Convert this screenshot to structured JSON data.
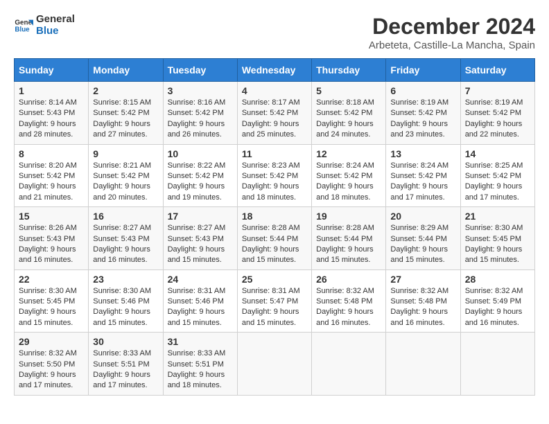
{
  "logo": {
    "line1": "General",
    "line2": "Blue"
  },
  "title": "December 2024",
  "subtitle": "Arbeteta, Castille-La Mancha, Spain",
  "days_header": [
    "Sunday",
    "Monday",
    "Tuesday",
    "Wednesday",
    "Thursday",
    "Friday",
    "Saturday"
  ],
  "weeks": [
    [
      {
        "day": "1",
        "sunrise": "8:14 AM",
        "sunset": "5:43 PM",
        "daylight": "9 hours and 28 minutes."
      },
      {
        "day": "2",
        "sunrise": "8:15 AM",
        "sunset": "5:42 PM",
        "daylight": "9 hours and 27 minutes."
      },
      {
        "day": "3",
        "sunrise": "8:16 AM",
        "sunset": "5:42 PM",
        "daylight": "9 hours and 26 minutes."
      },
      {
        "day": "4",
        "sunrise": "8:17 AM",
        "sunset": "5:42 PM",
        "daylight": "9 hours and 25 minutes."
      },
      {
        "day": "5",
        "sunrise": "8:18 AM",
        "sunset": "5:42 PM",
        "daylight": "9 hours and 24 minutes."
      },
      {
        "day": "6",
        "sunrise": "8:19 AM",
        "sunset": "5:42 PM",
        "daylight": "9 hours and 23 minutes."
      },
      {
        "day": "7",
        "sunrise": "8:19 AM",
        "sunset": "5:42 PM",
        "daylight": "9 hours and 22 minutes."
      }
    ],
    [
      {
        "day": "8",
        "sunrise": "8:20 AM",
        "sunset": "5:42 PM",
        "daylight": "9 hours and 21 minutes."
      },
      {
        "day": "9",
        "sunrise": "8:21 AM",
        "sunset": "5:42 PM",
        "daylight": "9 hours and 20 minutes."
      },
      {
        "day": "10",
        "sunrise": "8:22 AM",
        "sunset": "5:42 PM",
        "daylight": "9 hours and 19 minutes."
      },
      {
        "day": "11",
        "sunrise": "8:23 AM",
        "sunset": "5:42 PM",
        "daylight": "9 hours and 18 minutes."
      },
      {
        "day": "12",
        "sunrise": "8:24 AM",
        "sunset": "5:42 PM",
        "daylight": "9 hours and 18 minutes."
      },
      {
        "day": "13",
        "sunrise": "8:24 AM",
        "sunset": "5:42 PM",
        "daylight": "9 hours and 17 minutes."
      },
      {
        "day": "14",
        "sunrise": "8:25 AM",
        "sunset": "5:42 PM",
        "daylight": "9 hours and 17 minutes."
      }
    ],
    [
      {
        "day": "15",
        "sunrise": "8:26 AM",
        "sunset": "5:43 PM",
        "daylight": "9 hours and 16 minutes."
      },
      {
        "day": "16",
        "sunrise": "8:27 AM",
        "sunset": "5:43 PM",
        "daylight": "9 hours and 16 minutes."
      },
      {
        "day": "17",
        "sunrise": "8:27 AM",
        "sunset": "5:43 PM",
        "daylight": "9 hours and 15 minutes."
      },
      {
        "day": "18",
        "sunrise": "8:28 AM",
        "sunset": "5:44 PM",
        "daylight": "9 hours and 15 minutes."
      },
      {
        "day": "19",
        "sunrise": "8:28 AM",
        "sunset": "5:44 PM",
        "daylight": "9 hours and 15 minutes."
      },
      {
        "day": "20",
        "sunrise": "8:29 AM",
        "sunset": "5:44 PM",
        "daylight": "9 hours and 15 minutes."
      },
      {
        "day": "21",
        "sunrise": "8:30 AM",
        "sunset": "5:45 PM",
        "daylight": "9 hours and 15 minutes."
      }
    ],
    [
      {
        "day": "22",
        "sunrise": "8:30 AM",
        "sunset": "5:45 PM",
        "daylight": "9 hours and 15 minutes."
      },
      {
        "day": "23",
        "sunrise": "8:30 AM",
        "sunset": "5:46 PM",
        "daylight": "9 hours and 15 minutes."
      },
      {
        "day": "24",
        "sunrise": "8:31 AM",
        "sunset": "5:46 PM",
        "daylight": "9 hours and 15 minutes."
      },
      {
        "day": "25",
        "sunrise": "8:31 AM",
        "sunset": "5:47 PM",
        "daylight": "9 hours and 15 minutes."
      },
      {
        "day": "26",
        "sunrise": "8:32 AM",
        "sunset": "5:48 PM",
        "daylight": "9 hours and 16 minutes."
      },
      {
        "day": "27",
        "sunrise": "8:32 AM",
        "sunset": "5:48 PM",
        "daylight": "9 hours and 16 minutes."
      },
      {
        "day": "28",
        "sunrise": "8:32 AM",
        "sunset": "5:49 PM",
        "daylight": "9 hours and 16 minutes."
      }
    ],
    [
      {
        "day": "29",
        "sunrise": "8:32 AM",
        "sunset": "5:50 PM",
        "daylight": "9 hours and 17 minutes."
      },
      {
        "day": "30",
        "sunrise": "8:33 AM",
        "sunset": "5:51 PM",
        "daylight": "9 hours and 17 minutes."
      },
      {
        "day": "31",
        "sunrise": "8:33 AM",
        "sunset": "5:51 PM",
        "daylight": "9 hours and 18 minutes."
      },
      null,
      null,
      null,
      null
    ]
  ]
}
